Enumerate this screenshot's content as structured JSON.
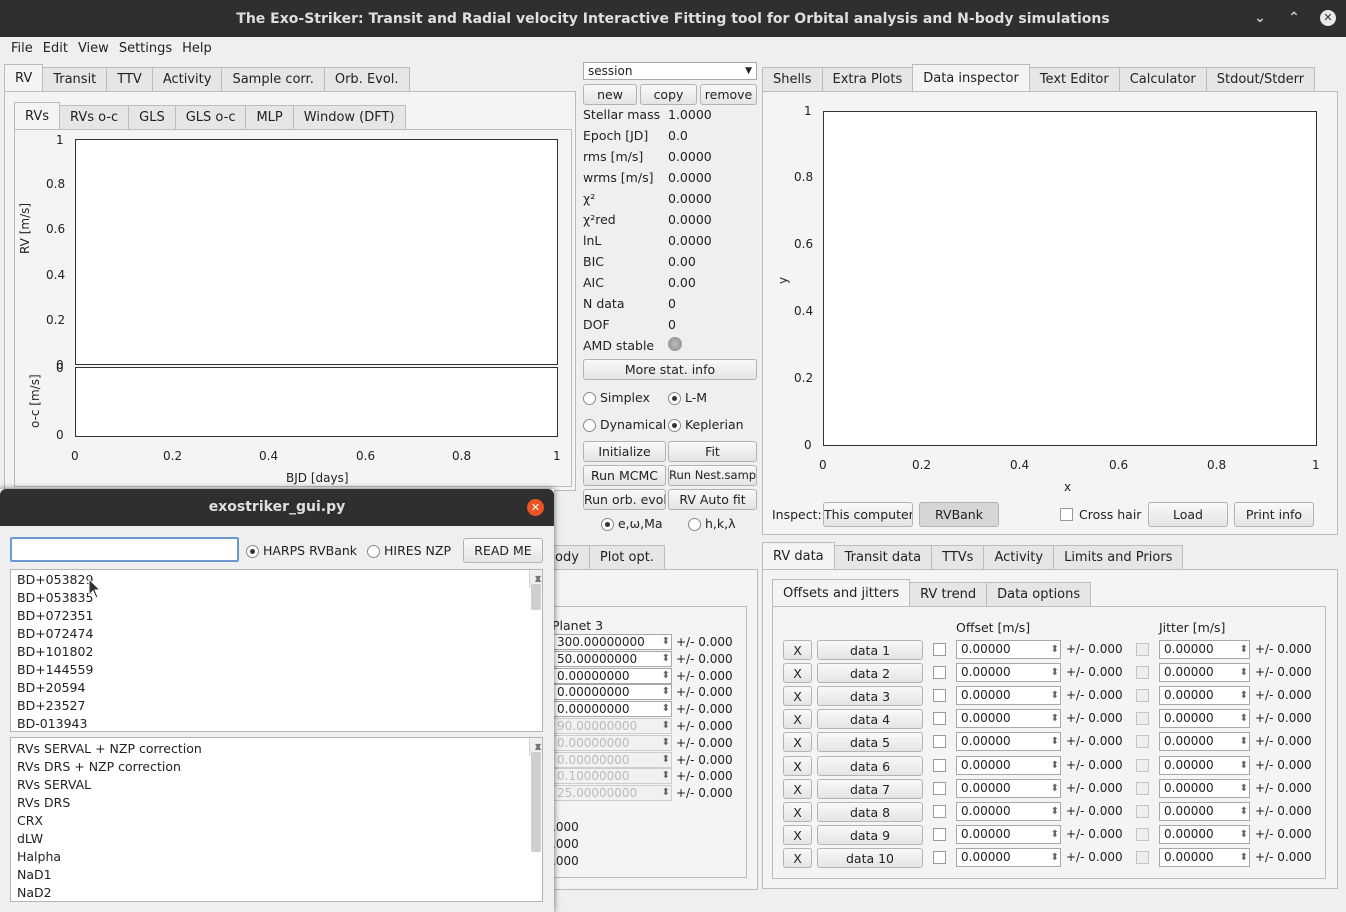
{
  "window": {
    "title": "The Exo-Striker:  Transit and Radial velocity Interactive Fitting tool for Orbital analysis and N-body simulations"
  },
  "menu": [
    "File",
    "Edit",
    "View",
    "Settings",
    "Help"
  ],
  "left_tabs": [
    "RV",
    "Transit",
    "TTV",
    "Activity",
    "Sample corr.",
    "Orb. Evol."
  ],
  "rv_subtabs": [
    "RVs",
    "RVs o-c",
    "GLS",
    "GLS o-c",
    "MLP",
    "Window (DFT)"
  ],
  "rv_plot": {
    "ylabel": "RV [m/s]",
    "oc_ylabel": "o-c [m/s]",
    "xlabel": "BJD [days]",
    "yticks": [
      "1",
      "0.8",
      "0.6",
      "0.4",
      "0.2",
      "0"
    ],
    "xticks": [
      "0",
      "0.2",
      "0.4",
      "0.6",
      "0.8",
      "1"
    ],
    "oc_yticks": [
      "0",
      "0"
    ]
  },
  "session": {
    "value": "session",
    "new": "new",
    "copy": "copy",
    "remove": "remove"
  },
  "stats": [
    {
      "label": "Stellar mass",
      "value": "1.0000"
    },
    {
      "label": "Epoch [JD]",
      "value": "0.0"
    },
    {
      "label": "rms [m/s]",
      "value": "0.0000"
    },
    {
      "label": "wrms [m/s]",
      "value": "0.0000"
    },
    {
      "label": "χ²",
      "value": "0.0000"
    },
    {
      "label": "χ²red",
      "value": "0.0000"
    },
    {
      "label": "lnL",
      "value": "0.0000"
    },
    {
      "label": "BIC",
      "value": "0.00"
    },
    {
      "label": "AIC",
      "value": "0.00"
    },
    {
      "label": "N data",
      "value": "0"
    },
    {
      "label": "DOF",
      "value": "0"
    },
    {
      "label": "AMD stable",
      "value": ""
    }
  ],
  "controls": {
    "more_stat": "More stat. info",
    "simplex": "Simplex",
    "lm": "L-M",
    "dynamical": "Dynamical",
    "keplerian": "Keplerian",
    "initialize": "Initialize",
    "fit": "Fit",
    "run_mcmc": "Run MCMC",
    "run_nest": "Run Nest.samp.",
    "run_orb": "Run orb. evol",
    "rv_auto": "RV Auto fit",
    "ewma": "e,ω,Ma",
    "hkl": "h,k,λ"
  },
  "right_tabs": [
    "Shells",
    "Extra Plots",
    "Data inspector",
    "Text Editor",
    "Calculator",
    "Stdout/Stderr"
  ],
  "inspector_plot": {
    "xlabel": "x",
    "ylabel": "y",
    "yticks": [
      "1",
      "0.8",
      "0.6",
      "0.4",
      "0.2",
      "0"
    ],
    "xticks": [
      "0",
      "0.2",
      "0.4",
      "0.6",
      "0.8",
      "1"
    ]
  },
  "inspect": {
    "label": "Inspect:",
    "this_computer": "This computer",
    "rvbank": "RVBank",
    "crosshair": "Cross hair",
    "load": "Load",
    "print": "Print info"
  },
  "bottom_tabs": [
    "RV data",
    "Transit data",
    "TTVs",
    "Activity",
    "Limits and Priors"
  ],
  "rvdata_subtabs": [
    "Offsets and jitters",
    "RV trend",
    "Data options"
  ],
  "offset_header": "Offset [m/s]",
  "jitter_header": "Jitter [m/s]",
  "datasets": [
    "data 1",
    "data 2",
    "data 3",
    "data 4",
    "data 5",
    "data 6",
    "data 7",
    "data 8",
    "data 9",
    "data 10"
  ],
  "offset_value": "0.00000",
  "pm_value": "+/- 0.000",
  "remove_label": "X",
  "mid_tabs": [
    "ody",
    "Plot opt."
  ],
  "planet3": {
    "title": "Planet 3",
    "values": [
      "300.00000000",
      "50.00000000",
      "0.00000000",
      "0.00000000",
      "0.00000000",
      "90.00000000",
      "0.00000000",
      "0.00000000",
      "0.10000000",
      "25.00000000"
    ],
    "extra": [
      ".000",
      ".000",
      ".000"
    ]
  },
  "dialog": {
    "title": "exostriker_gui.py",
    "search_placeholder": "",
    "harps": "HARPS RVBank",
    "hires": "HIRES NZP",
    "readme": "READ ME",
    "stars": [
      "BD+053829",
      "BD+053835",
      "BD+072351",
      "BD+072474",
      "BD+101802",
      "BD+144559",
      "BD+20594",
      "BD+23527",
      "BD-013943"
    ],
    "products": [
      "RVs SERVAL + NZP correction",
      "RVs DRS + NZP correction",
      "RVs SERVAL",
      "RVs DRS",
      "CRX",
      "dLW",
      "Halpha",
      "NaD1",
      "NaD2"
    ]
  }
}
